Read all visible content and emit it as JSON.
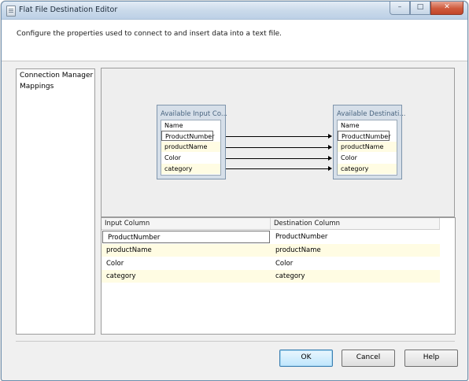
{
  "window": {
    "title": "Flat File Destination Editor",
    "controls": {
      "minimize": "–",
      "maximize": "□",
      "close": "✕"
    }
  },
  "header": {
    "description": "Configure the properties used to connect to and insert data into a text file."
  },
  "nav": {
    "items": [
      "Connection Manager",
      "Mappings"
    ]
  },
  "diagram": {
    "input_table": {
      "title": "Available Input Co...",
      "header": "Name",
      "rows": [
        "ProductNumber",
        "productName",
        "Color",
        "category"
      ]
    },
    "dest_table": {
      "title": "Available Destinati...",
      "header": "Name",
      "rows": [
        "ProductNumber",
        "productName",
        "Color",
        "category"
      ]
    }
  },
  "grid": {
    "columns": [
      "Input Column",
      "Destination Column"
    ],
    "rows": [
      [
        "ProductNumber",
        "ProductNumber"
      ],
      [
        "productName",
        "productName"
      ],
      [
        "Color",
        "Color"
      ],
      [
        "category",
        "category"
      ]
    ]
  },
  "buttons": {
    "ok": "OK",
    "cancel": "Cancel",
    "help": "Help"
  }
}
